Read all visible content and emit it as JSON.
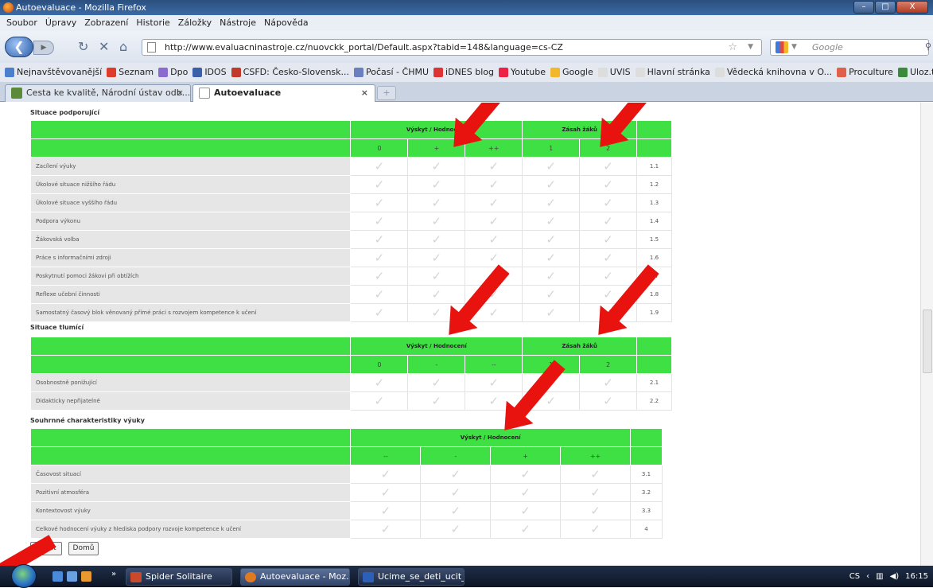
{
  "window": {
    "title": "Autoevaluace - Mozilla Firefox",
    "minimize": "–",
    "maximize": "□",
    "close": "X"
  },
  "menu": [
    "Soubor",
    "Úpravy",
    "Zobrazení",
    "Historie",
    "Záložky",
    "Nástroje",
    "Nápověda"
  ],
  "nav": {
    "url": "http://www.evaluacninastroje.cz/nuovckk_portal/Default.aspx?tabid=148&language=cs-CZ",
    "search_placeholder": "Google"
  },
  "bookmarks": [
    {
      "label": "Nejnavštěvovanější",
      "color": "#4a7fd0"
    },
    {
      "label": "Seznam",
      "color": "#e03a2a"
    },
    {
      "label": "Dpo",
      "color": "#8a6bd0"
    },
    {
      "label": "IDOS",
      "color": "#3b5fa8"
    },
    {
      "label": "CSFD: Česko-Slovensk...",
      "color": "#c0392b"
    },
    {
      "label": "Počasí - ČHMU",
      "color": "#6a7fbf"
    },
    {
      "label": "iDNES blog",
      "color": "#d33"
    },
    {
      "label": "Youtube",
      "color": "#e24"
    },
    {
      "label": "Google",
      "color": "#f2b72b"
    },
    {
      "label": "UVIS",
      "color": "#ddd"
    },
    {
      "label": "Hlavní stránka",
      "color": "#ddd"
    },
    {
      "label": "Vědecká knihovna v O...",
      "color": "#ddd"
    },
    {
      "label": "Proculture",
      "color": "#e0604a"
    },
    {
      "label": "Uloz.to!",
      "color": "#3a8a3a"
    }
  ],
  "tabs": [
    {
      "label": "Cesta ke kvalitě, Národní ústav odb...",
      "close": "×"
    },
    {
      "label": "Autoevaluace",
      "close": "×"
    }
  ],
  "new_tab": "+",
  "section1": {
    "title": "Situace podporující",
    "group1": "Výskyt / Hodnocení",
    "group2": "Zásah žáků",
    "cols": [
      "0",
      "+",
      "++",
      "1",
      "2"
    ],
    "rows": [
      {
        "label": "Zacílení výuky",
        "num": "1.1"
      },
      {
        "label": "Úkolové situace nižšího řádu",
        "num": "1.2"
      },
      {
        "label": "Úkolové situace vyššího řádu",
        "num": "1.3"
      },
      {
        "label": "Podpora výkonu",
        "num": "1.4"
      },
      {
        "label": "Žákovská volba",
        "num": "1.5"
      },
      {
        "label": "Práce s informačními zdroji",
        "num": "1.6"
      },
      {
        "label": "Poskytnutí pomoci žákovi při obtížích",
        "num": "1.7"
      },
      {
        "label": "Reflexe učební činnosti",
        "num": "1.8"
      },
      {
        "label": "Samostatný časový blok věnovaný přímé práci s rozvojem kompetence k učení",
        "num": "1.9"
      }
    ]
  },
  "section2": {
    "title": "Situace tlumící",
    "group1": "Výskyt / Hodnocení",
    "group2": "Zásah žáků",
    "cols": [
      "0",
      "-",
      "--",
      "1",
      "2"
    ],
    "rows": [
      {
        "label": "Osobnostně ponižující",
        "num": "2.1"
      },
      {
        "label": "Didakticky nepřijatelné",
        "num": "2.2"
      }
    ]
  },
  "section3": {
    "title": "Souhrnné charakteristiky výuky",
    "group1": "Výskyt / Hodnocení",
    "cols": [
      "--",
      "-",
      "+",
      "++"
    ],
    "rows": [
      {
        "label": "Časovost situací",
        "num": "3.1"
      },
      {
        "label": "Pozitivní atmosféra",
        "num": "3.2"
      },
      {
        "label": "Kontextovost výuky",
        "num": "3.3"
      },
      {
        "label": "Celkové hodnocení výuky z hlediska podpory rozvoje kompetence k učení",
        "num": "4"
      }
    ]
  },
  "check_glyph": "✓",
  "buttons": {
    "save": "Uložit",
    "home": "Domů"
  },
  "taskbar": {
    "items": [
      "Spider Solitaire",
      "Autoevaluace - Moz...",
      "Ucime_se_deti_ucit_..."
    ],
    "lang": "CS",
    "time": "16:15",
    "more": "»"
  },
  "accent_colors": {
    "table_header": "#3fe043",
    "arrow": "#e8120f"
  }
}
